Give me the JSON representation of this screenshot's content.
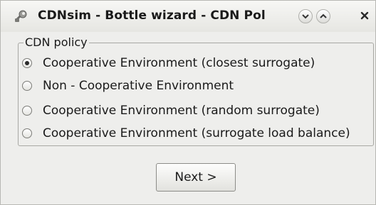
{
  "window": {
    "title": "CDNsim - Bottle wizard - CDN Pol",
    "app_icon": "wrench-icon",
    "controls": {
      "minimize_icon": "chevron-down-icon",
      "maximize_icon": "chevron-up-icon",
      "close_icon": "close-icon"
    }
  },
  "policy_group": {
    "title": "CDN policy",
    "options": [
      {
        "label": "Cooperative Environment (closest surrogate)",
        "selected": true
      },
      {
        "label": "Non - Cooperative Environment",
        "selected": false
      },
      {
        "label": "Cooperative Environment (random surrogate)",
        "selected": false
      },
      {
        "label": "Cooperative Environment (surrogate load balance)",
        "selected": false
      }
    ]
  },
  "actions": {
    "next_label": "Next >"
  }
}
